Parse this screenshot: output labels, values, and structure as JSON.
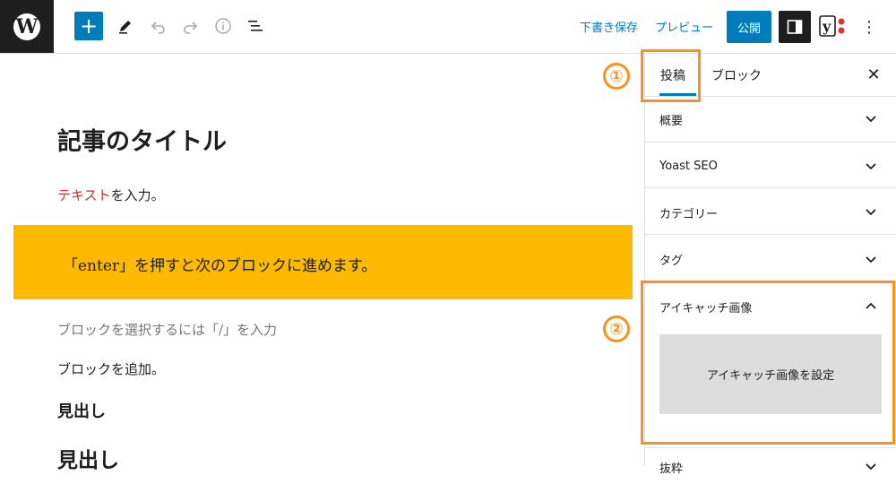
{
  "toolbar": {
    "logo_letter": "W",
    "add_symbol": "+",
    "save_draft": "下書き保存",
    "preview": "プレビュー",
    "publish": "公開",
    "yoast_letter": "y",
    "more_symbol": "⋮"
  },
  "editor": {
    "title": "記事のタイトル",
    "para1_highlight": "テキスト",
    "para1_rest": "を入力。",
    "highlight_text": "「enter」を押すと次のブロックに進めます。",
    "placeholder": "ブロックを選択するには「/」を入力",
    "para2": "ブロックを追加。",
    "heading_small": "見出し",
    "heading_large": "見出し"
  },
  "sidebar": {
    "tabs": [
      {
        "label": "投稿"
      },
      {
        "label": "ブロック"
      }
    ],
    "close_symbol": "✕",
    "panels": [
      {
        "label": "概要"
      },
      {
        "label": "Yoast SEO"
      },
      {
        "label": "カテゴリー"
      },
      {
        "label": "タグ"
      },
      {
        "label": "アイキャッチ画像"
      },
      {
        "label": "抜粋"
      }
    ],
    "featured_image_button": "アイキャッチ画像を設定"
  },
  "annotations": {
    "one": "①",
    "two": "②"
  },
  "colors": {
    "accent": "#007cba",
    "highlight_bg": "#fcb900",
    "red_text": "#cf2e2e",
    "annotation": "#f7931e"
  }
}
